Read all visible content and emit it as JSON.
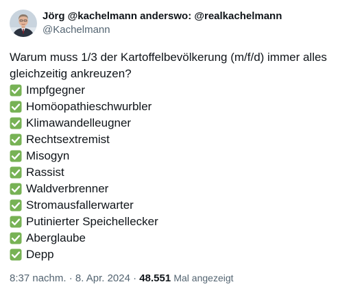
{
  "author": {
    "display_name": "Jörg @kachelmann anderswo: @realkachelmann",
    "handle": "@Kachelmann"
  },
  "tweet": {
    "intro": "Warum muss 1/3 der Kartoffelbevölkerung (m/f/d)  immer alles gleichzeitig ankreuzen?",
    "items": [
      {
        "label": "Impfgegner",
        "icon": "check-mark-button-icon"
      },
      {
        "label": "Homöopathieschwurbler",
        "icon": "check-mark-button-icon"
      },
      {
        "label": "Klimawandelleugner",
        "icon": "check-mark-button-icon"
      },
      {
        "label": "Rechtsextremist",
        "icon": "check-mark-button-icon"
      },
      {
        "label": "Misogyn",
        "icon": "check-mark-button-icon"
      },
      {
        "label": "Rassist",
        "icon": "check-mark-button-icon"
      },
      {
        "label": "Waldverbrenner",
        "icon": "check-mark-button-icon"
      },
      {
        "label": "Stromausfallerwarter",
        "icon": "check-mark-button-icon"
      },
      {
        "label": "Putinierter Speichellecker",
        "icon": "check-mark-button-icon"
      },
      {
        "label": "Aberglaube",
        "icon": "check-mark-button-icon"
      },
      {
        "label": "Depp",
        "icon": "check-mark-button-icon"
      }
    ]
  },
  "meta": {
    "timestamp": "8:37 nachm. · 8. Apr. 2024",
    "separator": "·",
    "views_count": "48.551",
    "views_label": "Mal angezeigt"
  },
  "colors": {
    "text_primary": "#0f1419",
    "text_secondary": "#536471",
    "check_green": "#77b255"
  }
}
